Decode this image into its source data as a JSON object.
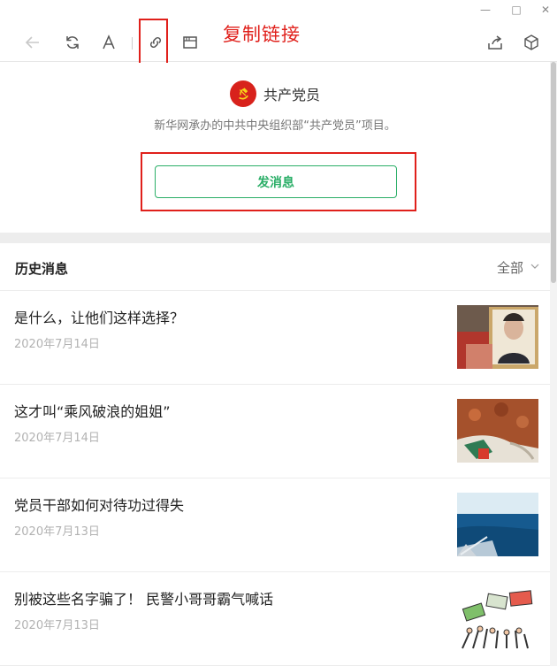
{
  "window_controls": {
    "minimize": "—",
    "maximize": "□",
    "close": "✕"
  },
  "toolbar": {
    "icons": [
      "back-arrow-icon",
      "refresh-icon",
      "font-icon",
      "link-icon",
      "window-icon",
      "share-icon",
      "cube-icon"
    ]
  },
  "annotation": {
    "copy_link_label": "复制链接",
    "color": "#e0201b"
  },
  "account": {
    "name": "共产党员",
    "description": "新华网承办的中共中央组织部“共产党员”项目。",
    "send_message_label": "发消息",
    "accent": "#2aae67",
    "logo_color": "#d8221c"
  },
  "history": {
    "title": "历史消息",
    "filter_label": "全部",
    "articles": [
      {
        "title": "是什么，让他们这样选择？",
        "date": "2020年7月14日"
      },
      {
        "title": "这才叫“乘风破浪的姐姐”",
        "date": "2020年7月14日"
      },
      {
        "title": "党员干部如何对待功过得失",
        "date": "2020年7月13日"
      },
      {
        "title": "别被这些名字骗了！ 民警小哥哥霸气喊话",
        "date": "2020年7月13日"
      }
    ]
  }
}
